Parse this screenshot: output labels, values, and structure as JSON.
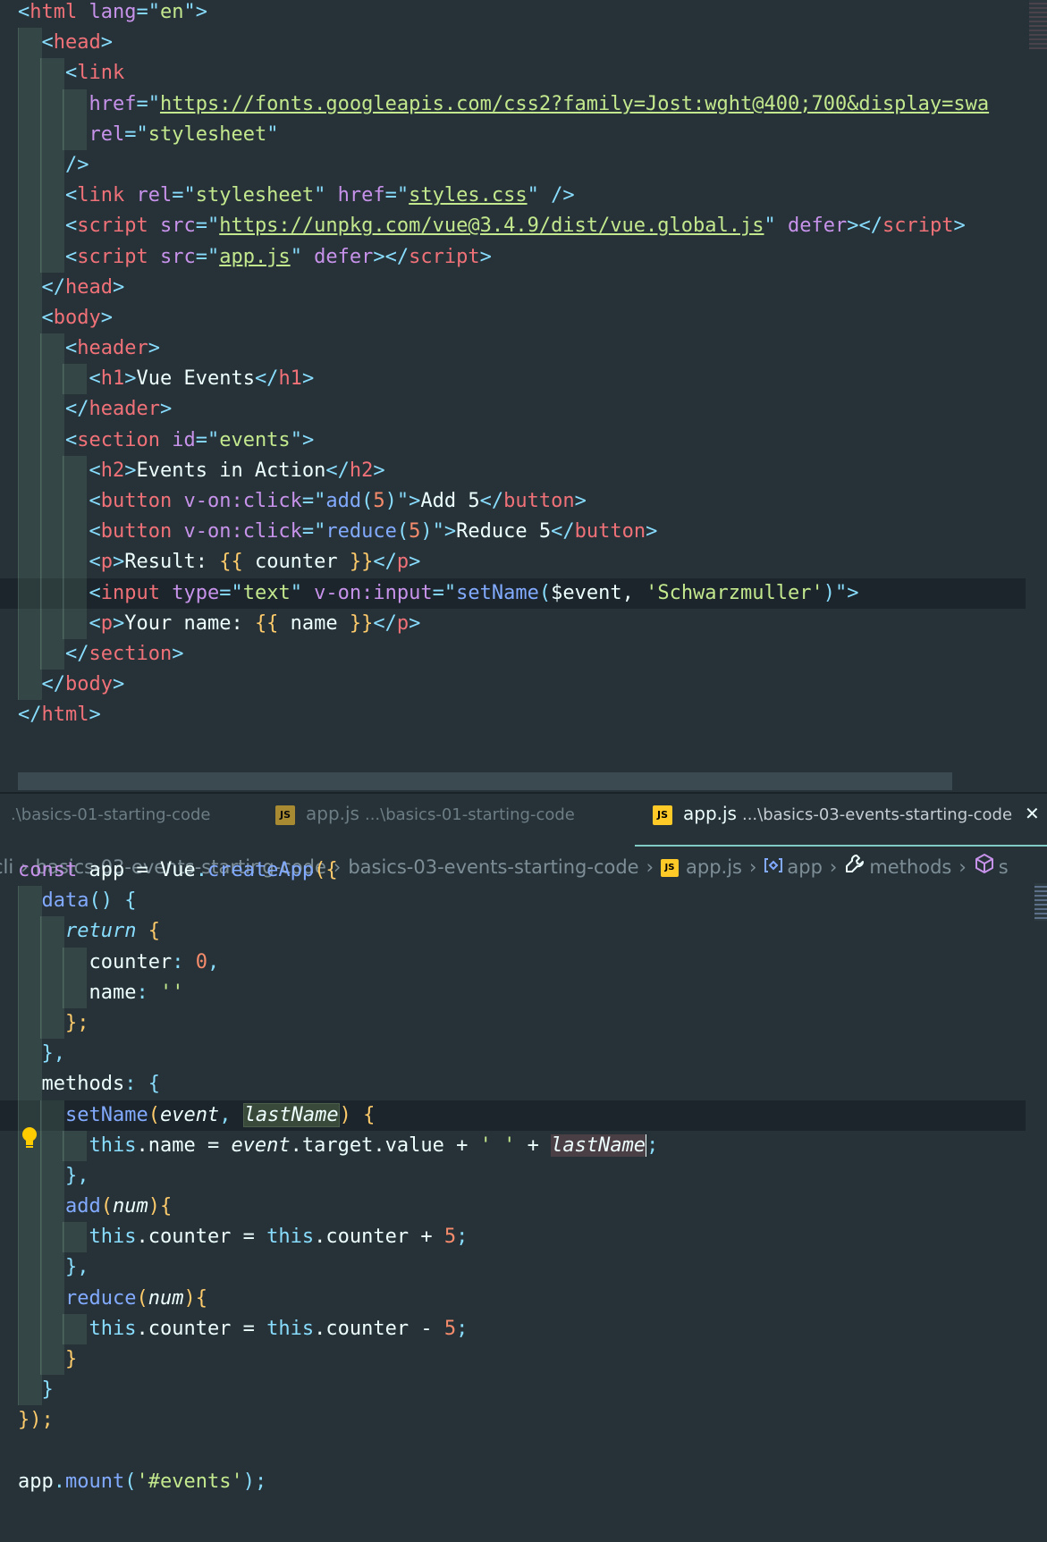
{
  "html_code": {
    "lines": [
      {
        "tokens": [
          [
            "<",
            "punc"
          ],
          [
            "html",
            "tag"
          ],
          [
            " lang",
            "attr"
          ],
          [
            "=\"",
            "punc"
          ],
          [
            "en",
            "str"
          ],
          [
            "\"",
            "punc"
          ],
          [
            ">",
            "punc"
          ]
        ],
        "indent": 0
      },
      {
        "tokens": [
          [
            "<",
            "punc"
          ],
          [
            "head",
            "tag"
          ],
          [
            ">",
            "punc"
          ]
        ],
        "indent": 1
      },
      {
        "tokens": [
          [
            "<",
            "punc"
          ],
          [
            "link",
            "tag"
          ]
        ],
        "indent": 2
      },
      {
        "tokens": [
          [
            "href",
            "attr"
          ],
          [
            "=\"",
            "punc"
          ],
          [
            "https://fonts.googleapis.com/css2?family=Jost:wght@400;700&display=swa",
            "url"
          ]
        ],
        "indent": 3
      },
      {
        "tokens": [
          [
            "rel",
            "attr"
          ],
          [
            "=\"",
            "punc"
          ],
          [
            "stylesheet",
            "str"
          ],
          [
            "\"",
            "punc"
          ]
        ],
        "indent": 3
      },
      {
        "tokens": [
          [
            "/>",
            "punc"
          ]
        ],
        "indent": 2
      },
      {
        "tokens": [
          [
            "<",
            "punc"
          ],
          [
            "link",
            "tag"
          ],
          [
            " rel",
            "attr"
          ],
          [
            "=\"",
            "punc"
          ],
          [
            "stylesheet",
            "str"
          ],
          [
            "\"",
            "punc"
          ],
          [
            " href",
            "attr"
          ],
          [
            "=\"",
            "punc"
          ],
          [
            "styles.css",
            "url"
          ],
          [
            "\"",
            "punc"
          ],
          [
            " />",
            "punc"
          ]
        ],
        "indent": 2
      },
      {
        "tokens": [
          [
            "<",
            "punc"
          ],
          [
            "script",
            "tag"
          ],
          [
            " src",
            "attr"
          ],
          [
            "=\"",
            "punc"
          ],
          [
            "https://unpkg.com/vue@3.4.9/dist/vue.global.js",
            "url"
          ],
          [
            "\"",
            "punc"
          ],
          [
            " defer",
            "attr"
          ],
          [
            "></",
            "punc"
          ],
          [
            "script",
            "tag"
          ],
          [
            ">",
            "punc"
          ]
        ],
        "indent": 2
      },
      {
        "tokens": [
          [
            "<",
            "punc"
          ],
          [
            "script",
            "tag"
          ],
          [
            " src",
            "attr"
          ],
          [
            "=\"",
            "punc"
          ],
          [
            "app.js",
            "url"
          ],
          [
            "\"",
            "punc"
          ],
          [
            " defer",
            "attr"
          ],
          [
            "></",
            "punc"
          ],
          [
            "script",
            "tag"
          ],
          [
            ">",
            "punc"
          ]
        ],
        "indent": 2
      },
      {
        "tokens": [
          [
            "</",
            "punc"
          ],
          [
            "head",
            "tag"
          ],
          [
            ">",
            "punc"
          ]
        ],
        "indent": 1
      },
      {
        "tokens": [
          [
            "<",
            "punc"
          ],
          [
            "body",
            "tag"
          ],
          [
            ">",
            "punc"
          ]
        ],
        "indent": 1
      },
      {
        "tokens": [
          [
            "<",
            "punc"
          ],
          [
            "header",
            "tag"
          ],
          [
            ">",
            "punc"
          ]
        ],
        "indent": 2
      },
      {
        "tokens": [
          [
            "<",
            "punc"
          ],
          [
            "h1",
            "tag"
          ],
          [
            ">",
            "punc"
          ],
          [
            "Vue Events",
            "text"
          ],
          [
            "</",
            "punc"
          ],
          [
            "h1",
            "tag"
          ],
          [
            ">",
            "punc"
          ]
        ],
        "indent": 3
      },
      {
        "tokens": [
          [
            "</",
            "punc"
          ],
          [
            "header",
            "tag"
          ],
          [
            ">",
            "punc"
          ]
        ],
        "indent": 2
      },
      {
        "tokens": [
          [
            "<",
            "punc"
          ],
          [
            "section",
            "tag"
          ],
          [
            " id",
            "attr"
          ],
          [
            "=\"",
            "punc"
          ],
          [
            "events",
            "str"
          ],
          [
            "\"",
            "punc"
          ],
          [
            ">",
            "punc"
          ]
        ],
        "indent": 2
      },
      {
        "tokens": [
          [
            "<",
            "punc"
          ],
          [
            "h2",
            "tag"
          ],
          [
            ">",
            "punc"
          ],
          [
            "Events in Action",
            "text"
          ],
          [
            "</",
            "punc"
          ],
          [
            "h2",
            "tag"
          ],
          [
            ">",
            "punc"
          ]
        ],
        "indent": 3
      },
      {
        "tokens": [
          [
            "<",
            "punc"
          ],
          [
            "button",
            "tag"
          ],
          [
            " v-on:click",
            "attr"
          ],
          [
            "=\"",
            "punc"
          ],
          [
            "add",
            "fn"
          ],
          [
            "(",
            "punc"
          ],
          [
            "5",
            "num"
          ],
          [
            ")",
            "punc"
          ],
          [
            "\">",
            "punc"
          ],
          [
            "Add 5",
            "text"
          ],
          [
            "</",
            "punc"
          ],
          [
            "button",
            "tag"
          ],
          [
            ">",
            "punc"
          ]
        ],
        "indent": 3
      },
      {
        "tokens": [
          [
            "<",
            "punc"
          ],
          [
            "button",
            "tag"
          ],
          [
            " v-on:click",
            "attr"
          ],
          [
            "=\"",
            "punc"
          ],
          [
            "reduce",
            "fn"
          ],
          [
            "(",
            "punc"
          ],
          [
            "5",
            "num"
          ],
          [
            ")",
            "punc"
          ],
          [
            "\">",
            "punc"
          ],
          [
            "Reduce 5",
            "text"
          ],
          [
            "</",
            "punc"
          ],
          [
            "button",
            "tag"
          ],
          [
            ">",
            "punc"
          ]
        ],
        "indent": 3
      },
      {
        "tokens": [
          [
            "<",
            "punc"
          ],
          [
            "p",
            "tag"
          ],
          [
            ">",
            "punc"
          ],
          [
            "Result: ",
            "text"
          ],
          [
            "{{",
            "brace"
          ],
          [
            " counter ",
            "text"
          ],
          [
            "}}",
            "brace"
          ],
          [
            "</",
            "punc"
          ],
          [
            "p",
            "tag"
          ],
          [
            ">",
            "punc"
          ]
        ],
        "indent": 3
      },
      {
        "tokens": [
          [
            "<",
            "punc"
          ],
          [
            "input",
            "tag"
          ],
          [
            " type",
            "attr"
          ],
          [
            "=\"",
            "punc"
          ],
          [
            "text",
            "str"
          ],
          [
            "\"",
            "punc"
          ],
          [
            " v-on:input",
            "attr"
          ],
          [
            "=\"",
            "punc"
          ],
          [
            "setName",
            "fn"
          ],
          [
            "(",
            "punc"
          ],
          [
            "$event, ",
            "text"
          ],
          [
            "'Schwarzmuller'",
            "str"
          ],
          [
            ")",
            "punc"
          ],
          [
            "\">",
            "punc"
          ]
        ],
        "indent": 3,
        "active": true
      },
      {
        "tokens": [
          [
            "<",
            "punc"
          ],
          [
            "p",
            "tag"
          ],
          [
            ">",
            "punc"
          ],
          [
            "Your name: ",
            "text"
          ],
          [
            "{{",
            "brace"
          ],
          [
            " name ",
            "text"
          ],
          [
            "}}",
            "brace"
          ],
          [
            "</",
            "punc"
          ],
          [
            "p",
            "tag"
          ],
          [
            ">",
            "punc"
          ]
        ],
        "indent": 3
      },
      {
        "tokens": [
          [
            "</",
            "punc"
          ],
          [
            "section",
            "tag"
          ],
          [
            ">",
            "punc"
          ]
        ],
        "indent": 2
      },
      {
        "tokens": [
          [
            "</",
            "punc"
          ],
          [
            "body",
            "tag"
          ],
          [
            ">",
            "punc"
          ]
        ],
        "indent": 1
      },
      {
        "tokens": [
          [
            "</",
            "punc"
          ],
          [
            "html",
            "tag"
          ],
          [
            ">",
            "punc"
          ]
        ],
        "indent": 0
      }
    ]
  },
  "tabs": [
    {
      "label": "",
      "path": ".\\basics-01-starting-code",
      "icon": "js-file-icon",
      "active": false
    },
    {
      "label": "app.js",
      "path": "...\\basics-01-starting-code",
      "icon": "js-file-icon",
      "active": false
    },
    {
      "label": "app.js",
      "path": "...\\basics-03-events-starting-code",
      "icon": "js-file-icon",
      "active": true
    }
  ],
  "breadcrumb": [
    "cli",
    "basics-03-events-starting-code",
    "basics-03-events-starting-code",
    "app.js",
    "app",
    "methods",
    "s"
  ],
  "js_code": {
    "lines": [
      {
        "tokens": [
          [
            "const",
            "kw"
          ],
          [
            " app = ",
            "prop"
          ],
          [
            "Vue",
            "prop"
          ],
          [
            ".",
            "punc"
          ],
          [
            "createApp",
            "fn"
          ],
          [
            "({",
            "brace"
          ]
        ],
        "indent": 0
      },
      {
        "tokens": [
          [
            "data",
            "fn"
          ],
          [
            "() ",
            "punc"
          ],
          [
            "{",
            "punc"
          ]
        ],
        "indent": 1
      },
      {
        "tokens": [
          [
            "return",
            "ret"
          ],
          [
            " {",
            "brace"
          ]
        ],
        "indent": 2
      },
      {
        "tokens": [
          [
            "counter",
            "prop"
          ],
          [
            ": ",
            "punc"
          ],
          [
            "0",
            "num"
          ],
          [
            ",",
            "punc"
          ]
        ],
        "indent": 3
      },
      {
        "tokens": [
          [
            "name",
            "prop"
          ],
          [
            ": ",
            "punc"
          ],
          [
            "''",
            "str"
          ]
        ],
        "indent": 3
      },
      {
        "tokens": [
          [
            "};",
            "brace"
          ]
        ],
        "indent": 2
      },
      {
        "tokens": [
          [
            "},",
            "punc"
          ]
        ],
        "indent": 1
      },
      {
        "tokens": [
          [
            "methods",
            "prop"
          ],
          [
            ": ",
            "punc"
          ],
          [
            "{",
            "punc"
          ]
        ],
        "indent": 1
      },
      {
        "tokens": [
          [
            "setName",
            "fn"
          ],
          [
            "(",
            "brace"
          ],
          [
            "event",
            "param"
          ],
          [
            ", ",
            "punc"
          ],
          [
            "lastName",
            "param-hl"
          ],
          [
            ")",
            "brace"
          ],
          [
            " {",
            "brace"
          ]
        ],
        "indent": 2,
        "active": true
      },
      {
        "tokens": [
          [
            "this",
            "this"
          ],
          [
            ".name = ",
            "prop"
          ],
          [
            "event",
            "param"
          ],
          [
            ".target.value + ",
            "prop"
          ],
          [
            "' '",
            "str"
          ],
          [
            " + ",
            "prop"
          ],
          [
            "lastName",
            "param-hl2"
          ],
          [
            ";",
            "punc"
          ]
        ],
        "indent": 3
      },
      {
        "tokens": [
          [
            "},",
            "punc"
          ]
        ],
        "indent": 2
      },
      {
        "tokens": [
          [
            "add",
            "fn"
          ],
          [
            "(",
            "brace"
          ],
          [
            "num",
            "param"
          ],
          [
            "){",
            "brace"
          ]
        ],
        "indent": 2
      },
      {
        "tokens": [
          [
            "this",
            "this"
          ],
          [
            ".counter = ",
            "prop"
          ],
          [
            "this",
            "this"
          ],
          [
            ".counter + ",
            "prop"
          ],
          [
            "5",
            "num"
          ],
          [
            ";",
            "punc"
          ]
        ],
        "indent": 3
      },
      {
        "tokens": [
          [
            "},",
            "punc"
          ]
        ],
        "indent": 2
      },
      {
        "tokens": [
          [
            "reduce",
            "fn"
          ],
          [
            "(",
            "brace"
          ],
          [
            "num",
            "param"
          ],
          [
            "){",
            "brace"
          ]
        ],
        "indent": 2
      },
      {
        "tokens": [
          [
            "this",
            "this"
          ],
          [
            ".counter = ",
            "prop"
          ],
          [
            "this",
            "this"
          ],
          [
            ".counter - ",
            "prop"
          ],
          [
            "5",
            "num"
          ],
          [
            ";",
            "punc"
          ]
        ],
        "indent": 3
      },
      {
        "tokens": [
          [
            "}",
            "brace"
          ]
        ],
        "indent": 2
      },
      {
        "tokens": [
          [
            "}",
            "punc"
          ]
        ],
        "indent": 1
      },
      {
        "tokens": [
          [
            "});",
            "brace"
          ]
        ],
        "indent": 0
      },
      {
        "tokens": [],
        "indent": 0
      },
      {
        "tokens": [
          [
            "app",
            "prop"
          ],
          [
            ".",
            "punc"
          ],
          [
            "mount",
            "fn"
          ],
          [
            "(",
            "punc"
          ],
          [
            "'#events'",
            "str"
          ],
          [
            ");",
            "punc"
          ]
        ],
        "indent": 0
      }
    ]
  },
  "colors": {
    "background": "#263238",
    "tag": "#f07178",
    "attr": "#c792ea",
    "string": "#c3e88d",
    "punctuation": "#89ddff",
    "function": "#82aaff",
    "number": "#f78c6c",
    "brace": "#ffcb6b",
    "js_icon": "#ffca28",
    "active_tab_underline": "#80cbc4"
  }
}
